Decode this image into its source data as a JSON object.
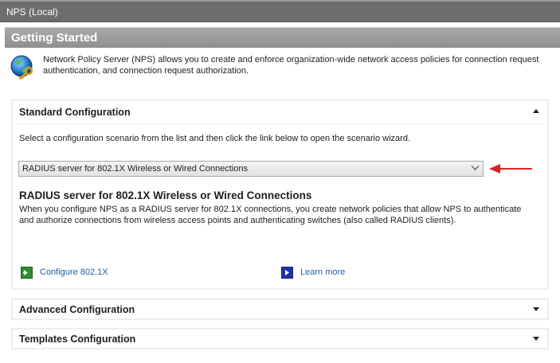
{
  "window": {
    "title": "NPS (Local)"
  },
  "section": {
    "title": "Getting Started"
  },
  "intro": {
    "text": "Network Policy Server (NPS) allows you to create and enforce organization-wide network access policies for connection request authentication, and connection request authorization."
  },
  "standard": {
    "title": "Standard Configuration",
    "instruction": "Select a configuration scenario from the list and then click the link below to open the scenario wizard.",
    "selected_scenario": "RADIUS server for 802.1X Wireless or Wired Connections",
    "scenario_title": "RADIUS server for 802.1X Wireless or Wired Connections",
    "scenario_description": "When you configure NPS as a RADIUS server for 802.1X connections, you create network policies that allow NPS to authenticate and authorize connections from wireless access points and authenticating switches (also called RADIUS clients).",
    "configure_link": "Configure 802.1X",
    "learn_more_link": "Learn more"
  },
  "advanced": {
    "title": "Advanced Configuration"
  },
  "templates": {
    "title": "Templates Configuration"
  },
  "colors": {
    "accent_link": "#1f5fa6",
    "arrow": "#e02020",
    "configure_icon": "#2e8b2e",
    "learn_icon": "#2233aa"
  }
}
